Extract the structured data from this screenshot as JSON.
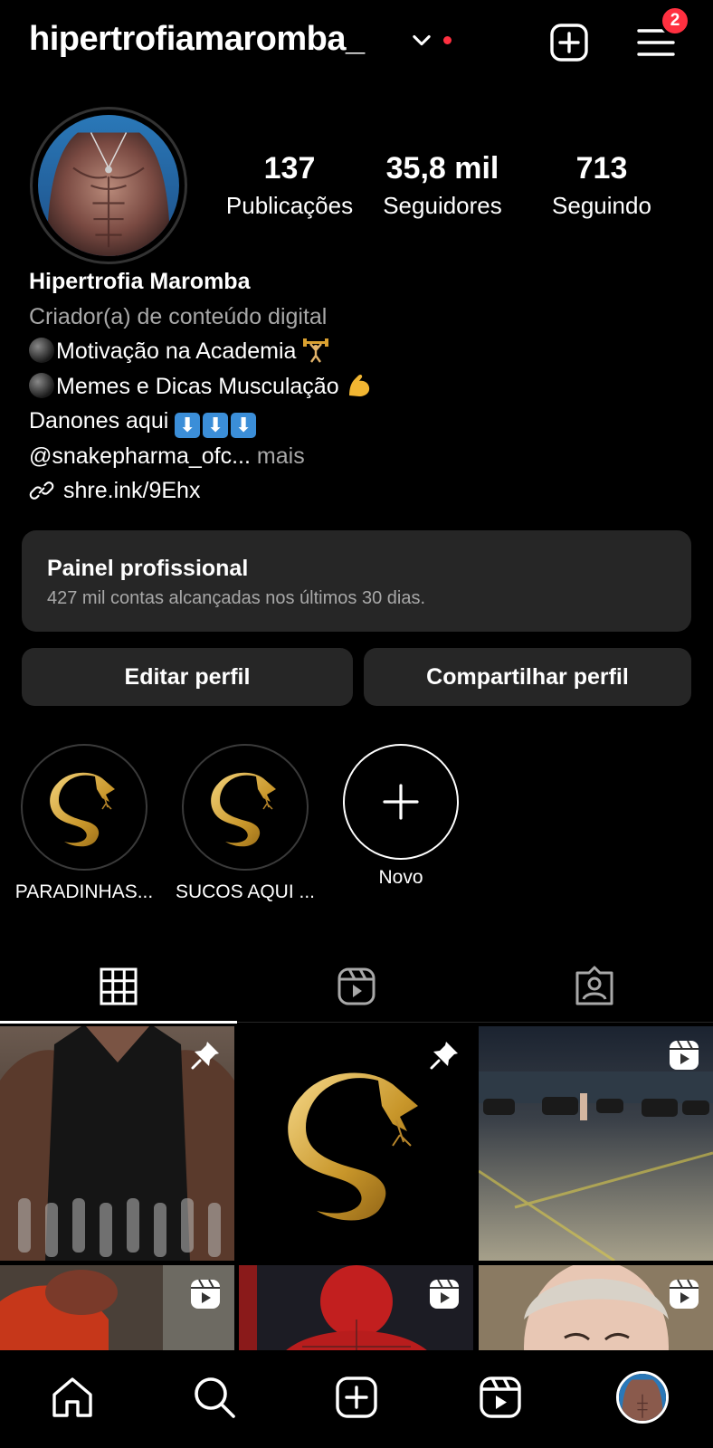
{
  "header": {
    "username": "hipertrofiamaromba_",
    "notification_badge": "2"
  },
  "profile": {
    "stats": [
      {
        "value": "137",
        "label": "Publicações"
      },
      {
        "value": "35,8 mil",
        "label": "Seguidores"
      },
      {
        "value": "713",
        "label": "Seguindo"
      }
    ],
    "name": "Hipertrofia Maromba",
    "category": "Criador(a) de conteúdo digital",
    "bio_lines": [
      "Motivação na Academia",
      "Memes e Dicas Musculação",
      "Danones aqui",
      "@snakepharma_ofc..."
    ],
    "more_label": "mais",
    "link": "shre.ink/9Ehx"
  },
  "dashboard": {
    "title": "Painel profissional",
    "subtitle": "427 mil contas alcançadas nos últimos 30 dias."
  },
  "buttons": {
    "edit": "Editar perfil",
    "share": "Compartilhar perfil"
  },
  "highlights": [
    {
      "label": "PARADINHAS..."
    },
    {
      "label": "SUCOS AQUI ..."
    },
    {
      "label": "Novo"
    }
  ],
  "colors": {
    "background": "#000000",
    "card": "#262626",
    "secondary_text": "#a8a8a8",
    "notification": "#ff3040",
    "gold": "#d4a93a"
  },
  "icons": {
    "tabs": [
      "grid-icon",
      "reels-icon",
      "tagged-icon"
    ],
    "nav": [
      "home-icon",
      "search-icon",
      "create-icon",
      "reels-icon",
      "profile-avatar"
    ]
  }
}
